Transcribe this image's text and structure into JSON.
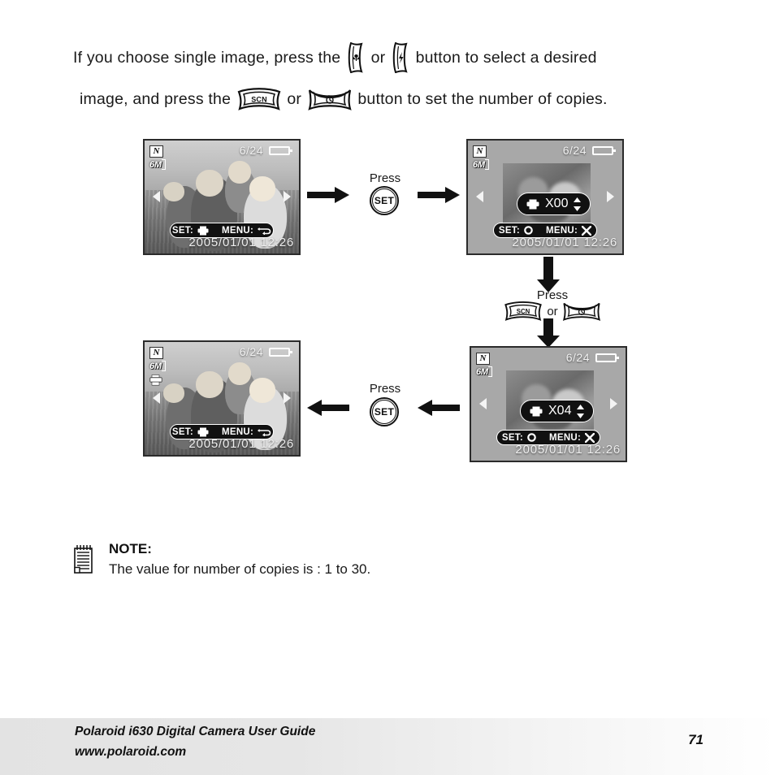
{
  "intro": {
    "line1_a": "If you choose single image, press the",
    "line1_or": "or",
    "line1_b": "button to select a desired",
    "line2_a": "image, and press  the",
    "line2_or": "or",
    "line2_b": "button to set the number of copies.",
    "icon_macro": "macro-button-icon",
    "icon_flash": "flash-button-icon",
    "icon_scn": "scn-button-icon",
    "icon_timer": "self-timer-button-icon",
    "scn_label": "SCN"
  },
  "screens": [
    {
      "id": "screen-playback",
      "mode_icon": "playback-mode-icon",
      "mode_glyph": "N",
      "resolution": "6M",
      "counter": "6/24",
      "battery": "battery-icon",
      "has_print_badge": false,
      "photo": "family-photo",
      "status_set_label": "SET:",
      "status_set_icon": "printer-icon",
      "status_menu_label": "MENU:",
      "status_menu_icon": "back-arrow-icon",
      "datetime": "2005/01/01  12:26",
      "popup": null
    },
    {
      "id": "screen-copies-00",
      "mode_icon": "playback-mode-icon",
      "mode_glyph": "N",
      "resolution": "6M",
      "counter": "6/24",
      "battery": "battery-icon",
      "has_print_badge": false,
      "photo": "thumbnail-photo",
      "status_set_label": "SET:",
      "status_set_icon": "circle-icon",
      "status_menu_label": "MENU:",
      "status_menu_icon": "cross-icon",
      "datetime": "2005/01/01  12:26",
      "popup": {
        "icon": "printer-icon",
        "value": "X00",
        "spinner": "up-down-arrows-icon"
      }
    },
    {
      "id": "screen-copies-04",
      "mode_icon": "playback-mode-icon",
      "mode_glyph": "N",
      "resolution": "6M",
      "counter": "6/24",
      "battery": "battery-icon",
      "has_print_badge": false,
      "photo": "thumbnail-photo",
      "status_set_label": "SET:",
      "status_set_icon": "circle-icon",
      "status_menu_label": "MENU:",
      "status_menu_icon": "cross-icon",
      "datetime": "2005/01/01  12:26",
      "popup": {
        "icon": "printer-icon",
        "value": "X04",
        "spinner": "up-down-arrows-icon"
      }
    },
    {
      "id": "screen-playback-marked",
      "mode_icon": "playback-mode-icon",
      "mode_glyph": "N",
      "resolution": "6M",
      "counter": "6/24",
      "battery": "battery-icon",
      "has_print_badge": true,
      "photo": "family-photo",
      "status_set_label": "SET:",
      "status_set_icon": "printer-icon",
      "status_menu_label": "MENU:",
      "status_menu_icon": "back-arrow-icon",
      "datetime": "2005/01/01  12:26",
      "popup": null
    }
  ],
  "flow": {
    "press_top_label": "Press",
    "press_top_button": "SET",
    "press_mid_label": "Press",
    "press_mid_or": "or",
    "press_mid_scn": "SCN",
    "press_bottom_label": "Press",
    "press_bottom_button": "SET"
  },
  "note": {
    "icon": "notepad-icon",
    "title": "NOTE:",
    "text": "The  value for number of copies is : 1 to 30."
  },
  "footer": {
    "line1": "Polaroid i630 Digital Camera User Guide",
    "line2": "www.polaroid.com",
    "page": "71"
  }
}
